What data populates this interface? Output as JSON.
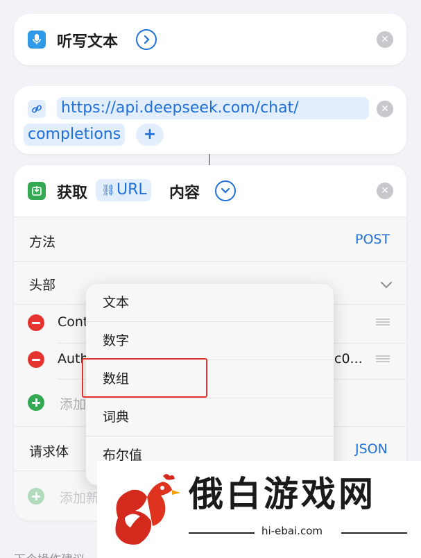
{
  "dictation_card": {
    "title": "听写文本"
  },
  "url_card": {
    "url_line1": "https://api.deepseek.com/chat/",
    "url_line2": "completions",
    "add_symbol": "+"
  },
  "fetch_card": {
    "title_prefix": "获取",
    "token_label": "URL",
    "title_suffix": "内容",
    "method_label": "方法",
    "method_value": "POST",
    "headers_label": "头部",
    "header_rows": [
      {
        "key": "Cont",
        "value": ""
      },
      {
        "key": "Auth",
        "value": "c0..."
      }
    ],
    "add_header_label": "添加",
    "body_label": "请求体",
    "body_value": "JSON",
    "add_field_label": "添加新"
  },
  "type_menu": {
    "items": [
      "文本",
      "数字",
      "数组",
      "词典",
      "布尔值"
    ],
    "highlighted": "数组"
  },
  "bottom_hint": "下个操作建议",
  "watermark": {
    "title": "俄白游戏网",
    "domain": "hi-ebai.com"
  },
  "colors": {
    "accent": "#1f6fd8",
    "destructive": "#e5342f",
    "add": "#34a853",
    "highlight": "#e5342f"
  }
}
